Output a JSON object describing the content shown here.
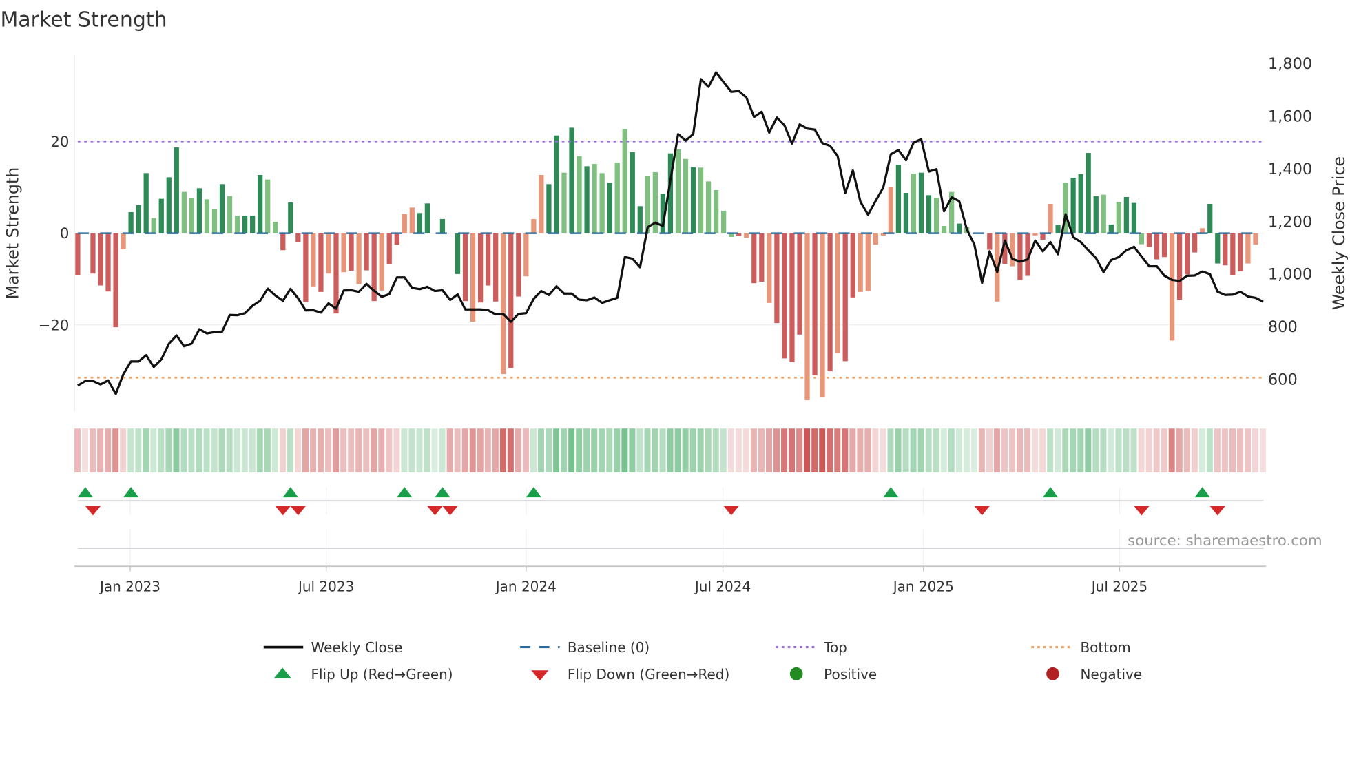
{
  "chart_data": {
    "type": "bar",
    "title": "Market Strength",
    "ylabel": "Market Strength",
    "y2label": "Weekly Close Price",
    "ylim": [
      -39,
      39
    ],
    "y2lim": [
      510,
      1830
    ],
    "y_ticks": [
      {
        "label": "20",
        "v": 20
      },
      {
        "label": "0",
        "v": 0
      },
      {
        "label": "−20",
        "v": -20
      }
    ],
    "y2_ticks": [
      {
        "label": "1,800",
        "v": 1800
      },
      {
        "label": "1,600",
        "v": 1600
      },
      {
        "label": "1,400",
        "v": 1400
      },
      {
        "label": "1,200",
        "v": 1200
      },
      {
        "label": "1,000",
        "v": 1000
      },
      {
        "label": "800",
        "v": 800
      },
      {
        "label": "600",
        "v": 600
      }
    ],
    "x_unit": "week index",
    "x_ticks": [
      {
        "label": "Jan 2023",
        "x": 6.9
      },
      {
        "label": "Jul 2023",
        "x": 32.7
      },
      {
        "label": "Jan 2024",
        "x": 59.0
      },
      {
        "label": "Jul 2024",
        "x": 84.9
      },
      {
        "label": "Jan 2025",
        "x": 111.3
      },
      {
        "label": "Jul 2025",
        "x": 137.1
      }
    ],
    "top_level": 20,
    "bottom_level": -31.5,
    "strength": [
      -9.2,
      0,
      -8.8,
      -11.4,
      -12.7,
      -20.5,
      -3.5,
      4.6,
      6.1,
      13.1,
      3.3,
      7.5,
      12.2,
      18.7,
      9.0,
      7.6,
      9.8,
      7.4,
      5.2,
      10.7,
      8.1,
      3.8,
      3.8,
      3.8,
      12.7,
      11.7,
      2.5,
      -3.7,
      6.7,
      -2.0,
      -15.0,
      -11.6,
      -12.8,
      -8.8,
      -17.5,
      -8.5,
      -8.2,
      -11.1,
      -8.1,
      -14.8,
      -12.5,
      -6.8,
      -2.5,
      4.2,
      5.6,
      4.4,
      6.5,
      0,
      3.1,
      -13.4,
      -8.9,
      -14.8,
      -19.3,
      -15.1,
      -11.4,
      -14.9,
      -30.7,
      -29.4,
      -13.8,
      -9.4,
      3.1,
      12.7,
      10.7,
      21.3,
      13.2,
      23.0,
      16.8,
      14.6,
      15.1,
      13.1,
      11.0,
      15.4,
      22.7,
      17.7,
      5.9,
      12.4,
      13.3,
      8.6,
      17.4,
      18.3,
      16.2,
      14.4,
      14.3,
      11.3,
      9.4,
      4.9,
      -0.8,
      -0.6,
      -1.0,
      -10.9,
      -10.6,
      -15.2,
      -19.6,
      -27.3,
      -28.1,
      -22.1,
      -36.4,
      -31.0,
      -35.7,
      -30.1,
      -26.1,
      -27.9,
      -14.0,
      -12.8,
      -12.6,
      -2.5,
      -0.5,
      10.0,
      14.9,
      8.8,
      13.0,
      13.2,
      8.3,
      7.7,
      1.6,
      9.0,
      2.1,
      1.3,
      0,
      -10.7,
      -3.6,
      -14.9,
      -6.7,
      -7.2,
      -10.2,
      -9.3,
      -0.5,
      -1.4,
      6.4,
      1.8,
      11.0,
      12.1,
      12.9,
      17.5,
      8.1,
      8.4,
      1.9,
      6.8,
      7.9,
      6.6,
      -2.4,
      -3.0,
      -5.7,
      -5.2,
      -23.4,
      -14.5,
      -9.0,
      -4.2,
      1.1,
      6.4,
      -6.6,
      -7.0,
      -9.2,
      -8.3,
      -6.6,
      -2.5,
      0
    ],
    "shade": "RZRRRRODDDLDDDLLDLLDLLDDDLLRDRRORORORORRORROODDLDZDRORRRORROOODDLDLDLLDLLDDLLDDLLDLLLLLRORRORRRRORORORROOOOODDLDDLLLDLLZRORORRORODLDDDDLDLDDLRRRORRRODDRRROOOZ",
    "weekly_close": [
      574,
      591,
      591,
      578,
      593,
      542,
      617,
      665,
      665,
      689,
      644,
      673,
      733,
      764,
      723,
      733,
      788,
      772,
      777,
      779,
      842,
      841,
      849,
      877,
      896,
      942,
      916,
      896,
      941,
      905,
      859,
      860,
      851,
      886,
      866,
      935,
      936,
      930,
      960,
      934,
      911,
      921,
      985,
      985,
      945,
      940,
      949,
      933,
      936,
      899,
      920,
      863,
      863,
      863,
      860,
      844,
      846,
      816,
      846,
      849,
      903,
      933,
      918,
      951,
      923,
      923,
      900,
      898,
      908,
      888,
      898,
      907,
      1062,
      1056,
      1023,
      1176,
      1193,
      1180,
      1354,
      1529,
      1505,
      1529,
      1738,
      1709,
      1764,
      1727,
      1690,
      1693,
      1668,
      1594,
      1614,
      1535,
      1592,
      1562,
      1493,
      1566,
      1550,
      1546,
      1495,
      1485,
      1446,
      1305,
      1391,
      1272,
      1223,
      1275,
      1326,
      1453,
      1469,
      1430,
      1497,
      1510,
      1387,
      1396,
      1236,
      1289,
      1274,
      1167,
      1109,
      964,
      1084,
      1005,
      1125,
      1055,
      1045,
      1053,
      1125,
      1084,
      1119,
      1073,
      1225,
      1138,
      1119,
      1088,
      1058,
      1005,
      1051,
      1062,
      1088,
      1101,
      1064,
      1027,
      1027,
      991,
      975,
      971,
      991,
      992,
      1007,
      997,
      930,
      918,
      919,
      930,
      912,
      907,
      892
    ],
    "flip_up_weeks": [
      1,
      7,
      28,
      43,
      48,
      60,
      107,
      128,
      148
    ],
    "flip_down_weeks": [
      2,
      27,
      29,
      47,
      49,
      86,
      119,
      140,
      150
    ],
    "colors": {
      "strong_positive": "#2e8b57",
      "weak_positive": "#7fbf7f",
      "strong_negative": "#cd5c5c",
      "weak_negative": "#e8967a",
      "baseline": "#2f6f9f",
      "top": "#9b6fe0",
      "bottom": "#f0a060",
      "line": "#111111",
      "flip_up": "#1a9e4a",
      "flip_down": "#d62828",
      "positive": "#228b22",
      "negative": "#b22222"
    },
    "legend": {
      "weekly_close": "Weekly Close",
      "baseline": "Baseline (0)",
      "top": "Top",
      "bottom": "Bottom",
      "flip_up": "Flip Up (Red→Green)",
      "flip_down": "Flip Down (Green→Red)",
      "positive": "Positive",
      "negative": "Negative"
    },
    "source": "source: sharemaestro.com"
  }
}
